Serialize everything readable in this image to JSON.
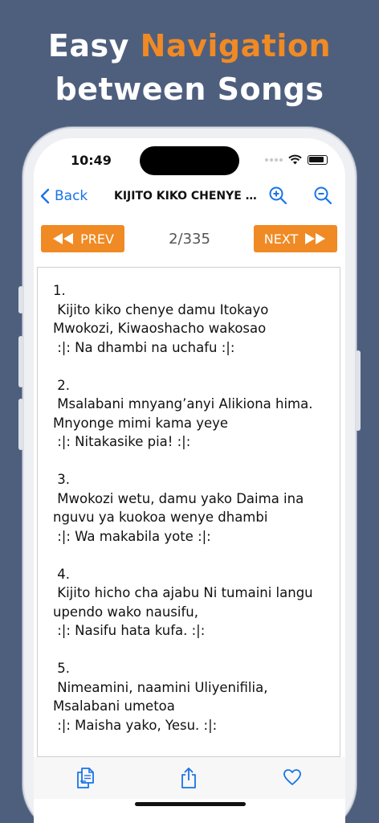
{
  "promo": {
    "line1_plain": "Easy ",
    "line1_accent": "Navigation",
    "line2": "between Songs"
  },
  "status": {
    "time": "10:49"
  },
  "navbar": {
    "back_label": "Back",
    "title": "KIJITO KIKO CHENYE DAMU"
  },
  "pager": {
    "prev_label": "PREV",
    "next_label": "NEXT",
    "position": "2/335"
  },
  "lyrics": [
    {
      "number": "1.",
      "lines": [
        " Kijito kiko chenye damu Itokayo",
        "Mwokozi, Kiwaoshacho wakosao",
        " :|: Na dhambi na uchafu :|:"
      ]
    },
    {
      "number": " 2.",
      "lines": [
        " Msalabani mnyang’anyi Alikiona hima.",
        "Mnyonge mimi kama yeye",
        " :|: Nitakasike pia! :|:"
      ]
    },
    {
      "number": " 3.",
      "lines": [
        " Mwokozi wetu, damu yako Daima ina",
        "nguvu ya kuokoa wenye dhambi",
        " :|: Wa makabila yote :|:"
      ]
    },
    {
      "number": " 4.",
      "lines": [
        " Kijito hicho cha ajabu Ni tumaini langu",
        "upendo wako nausifu,",
        " :|: Nasifu hata kufa. :|:"
      ]
    },
    {
      "number": " 5.",
      "lines": [
        " Nimeamini, naamini Uliyenifilia,",
        "Msalabani umetoa",
        " :|: Maisha yako, Yesu. :|:"
      ]
    }
  ],
  "colors": {
    "background": "#4e5f7e",
    "accent": "#f08a24",
    "link": "#1a73e8"
  },
  "icons": {
    "zoom_in": "zoom-in-icon",
    "zoom_out": "zoom-out-icon",
    "copy": "copy-icon",
    "share": "share-icon",
    "favorite": "heart-icon"
  }
}
